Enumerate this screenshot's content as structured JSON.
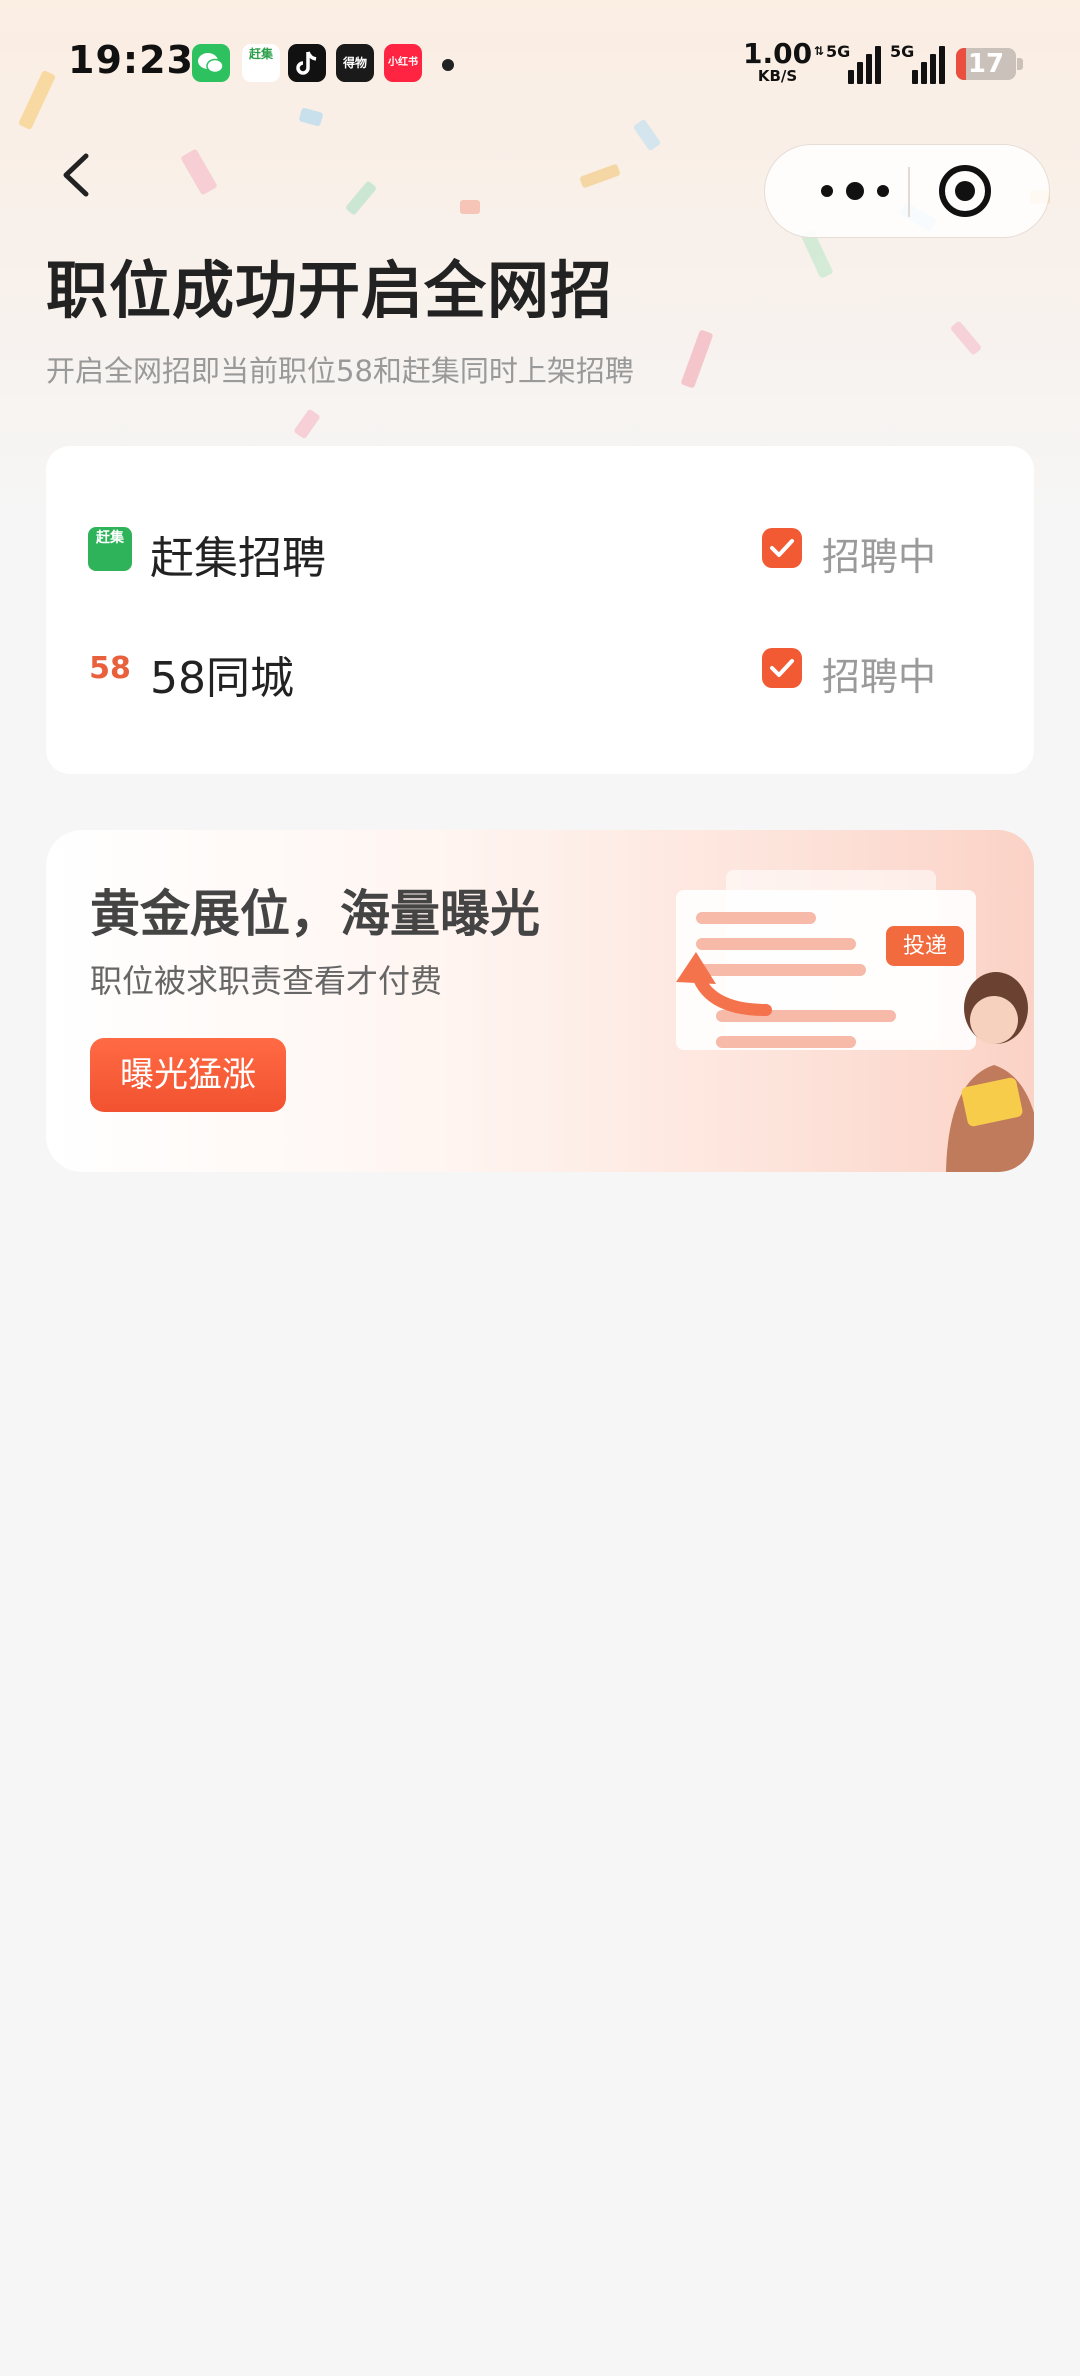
{
  "status_bar": {
    "time": "19:23",
    "apps": [
      {
        "name": "wechat-icon",
        "label": "",
        "color": "#2dc160"
      },
      {
        "name": "ganji-app-icon",
        "label": "赶集",
        "color": "#3cb95a"
      },
      {
        "name": "douyin-icon",
        "label": "",
        "color": "#111111"
      },
      {
        "name": "dewu-icon",
        "label": "得物",
        "color": "#1a1a1a"
      },
      {
        "name": "xiaohongshu-icon",
        "label": "小红书",
        "color": "#ff2442"
      }
    ],
    "net_speed_value": "1.00",
    "net_speed_unit": "KB/S",
    "signal_1_label": "5G",
    "signal_2_label": "5G",
    "battery": "17",
    "battery_level": 0.17
  },
  "header": {
    "title": "职位成功开启全网招",
    "subtitle": "开启全网招即当前职位58和赶集同时上架招聘"
  },
  "platforms": [
    {
      "logo_text": "赶集",
      "name": "赶集招聘",
      "status": "招聘中",
      "checked": true
    },
    {
      "logo_text": "58",
      "name": "58同城",
      "status": "招聘中",
      "checked": true
    }
  ],
  "promo": {
    "title": "黄金展位，海量曝光",
    "description": "职位被求职责查看才付费",
    "button_label": "曝光猛涨",
    "illustration_tag": "投递"
  },
  "colors": {
    "accent": "#f4572f",
    "check": "#f25a34",
    "title_text": "#222222",
    "muted_text": "#999999"
  }
}
